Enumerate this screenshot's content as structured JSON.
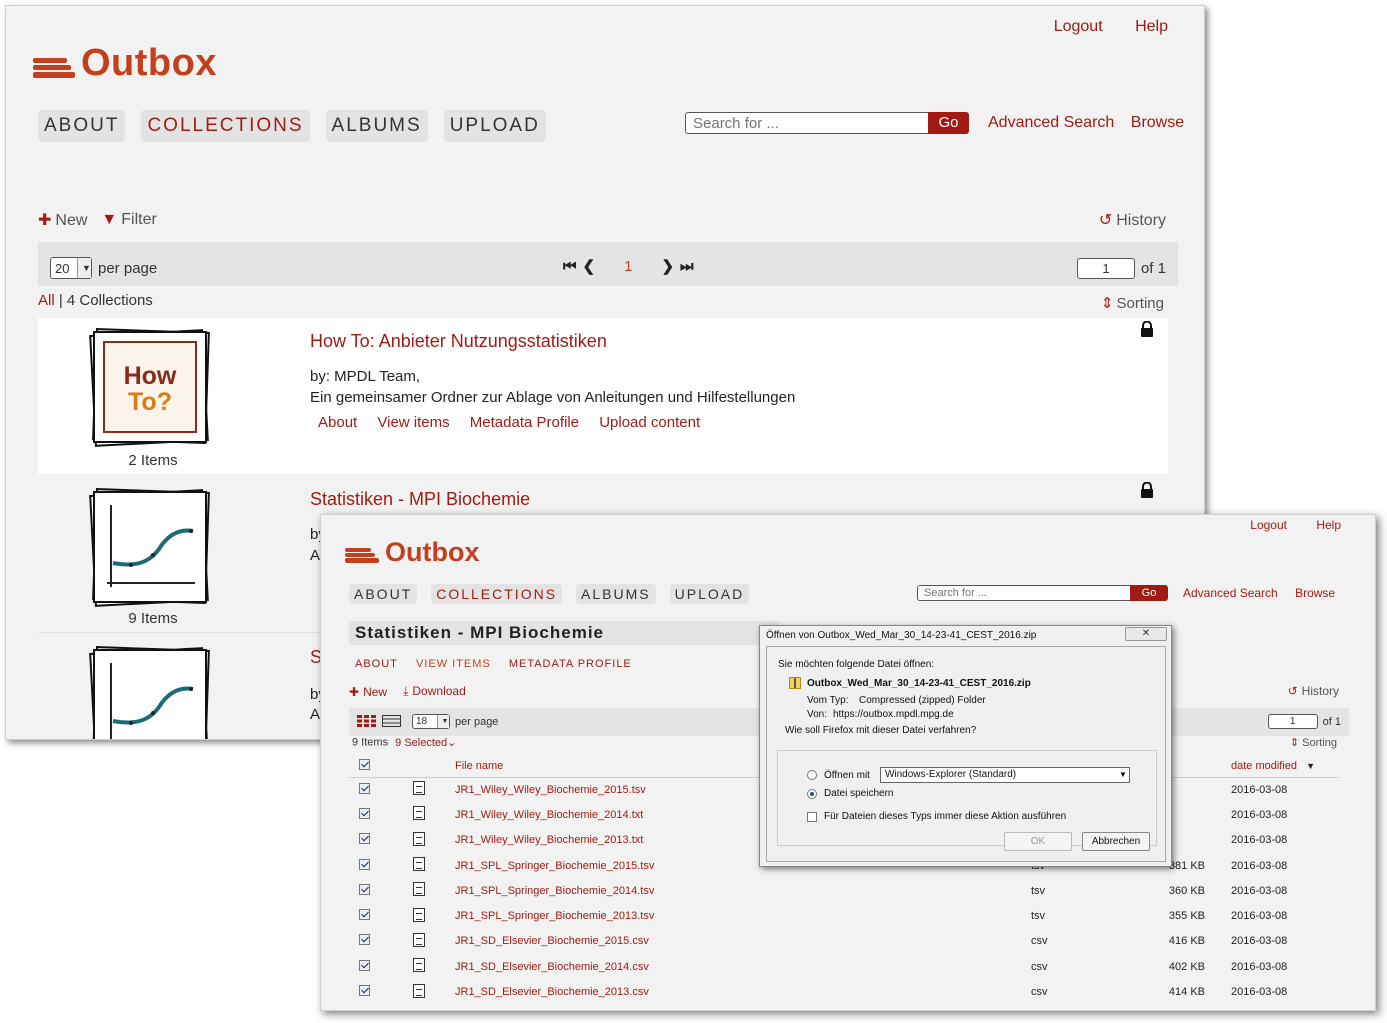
{
  "brand": {
    "name": "Outbox",
    "color": "#c2411c",
    "accent": "#a11b14"
  },
  "w1": {
    "top_links": [
      "Logout",
      "Help"
    ],
    "nav": [
      {
        "label": "ABOUT",
        "active": false
      },
      {
        "label": "COLLECTIONS",
        "active": true
      },
      {
        "label": "ALBUMS",
        "active": false
      },
      {
        "label": "UPLOAD",
        "active": false
      }
    ],
    "search": {
      "placeholder": "Search for ...",
      "go": "Go",
      "advanced": "Advanced Search",
      "browse": "Browse"
    },
    "toolbar": {
      "new": "New",
      "filter": "Filter",
      "history": "History"
    },
    "pager": {
      "per_page_value": "20",
      "per_page_label": "per page",
      "current_page": "1",
      "page_input": "1",
      "of_label": "of 1"
    },
    "count": {
      "all": "All",
      "separator": "|",
      "text": "4 Collections"
    },
    "sorting": "Sorting",
    "collections": [
      {
        "title": "How To: Anbieter Nutzungsstatistiken",
        "thumb_text": [
          "How",
          "To?"
        ],
        "by": "by: MPDL Team,",
        "description": "Ein gemeinsamer Ordner zur Ablage von Anleitungen und Hilfestellungen",
        "actions": [
          "About",
          "View items",
          "Metadata Profile",
          "Upload content"
        ],
        "items": "2 Items",
        "locked": true
      },
      {
        "title": "Statistiken - MPI Biochemie",
        "by": "by",
        "description": "A",
        "items": "9 Items",
        "locked": true
      },
      {
        "title": "S",
        "by": "by",
        "description": "A",
        "locked": false
      }
    ]
  },
  "w2": {
    "top_links": [
      "Logout",
      "Help"
    ],
    "nav": [
      {
        "label": "ABOUT",
        "active": false
      },
      {
        "label": "COLLECTIONS",
        "active": true
      },
      {
        "label": "ALBUMS",
        "active": false
      },
      {
        "label": "UPLOAD",
        "active": false
      }
    ],
    "search": {
      "placeholder": "Search for ...",
      "go": "Go",
      "advanced": "Advanced Search",
      "browse": "Browse"
    },
    "page_title": "Statistiken - MPI Biochemie",
    "subnav": [
      {
        "label": "ABOUT",
        "active": false
      },
      {
        "label": "VIEW ITEMS",
        "active": true
      },
      {
        "label": "METADATA PROFILE",
        "active": false
      }
    ],
    "toolbar": {
      "new": "New",
      "download": "Download",
      "history": "History"
    },
    "pager": {
      "per_page_value": "18",
      "per_page_label": "per page",
      "page_input": "1",
      "of_label": "of 1"
    },
    "count": {
      "items": "9 Items",
      "selected": "9 Selected"
    },
    "sorting": "Sorting",
    "table": {
      "headers": {
        "file_name": "File name",
        "date_modified": "date modified"
      },
      "rows": [
        {
          "name": "JR1_Wiley_Wiley_Biochemie_2015.tsv",
          "type": "",
          "size": "",
          "date": "2016-03-08"
        },
        {
          "name": "JR1_Wiley_Wiley_Biochemie_2014.txt",
          "type": "",
          "size": "",
          "date": "2016-03-08"
        },
        {
          "name": "JR1_Wiley_Wiley_Biochemie_2013.txt",
          "type": "",
          "size": "",
          "date": "2016-03-08"
        },
        {
          "name": "JR1_SPL_Springer_Biochemie_2015.tsv",
          "type": "tsv",
          "size": "381 KB",
          "date": "2016-03-08"
        },
        {
          "name": "JR1_SPL_Springer_Biochemie_2014.tsv",
          "type": "tsv",
          "size": "360 KB",
          "date": "2016-03-08"
        },
        {
          "name": "JR1_SPL_Springer_Biochemie_2013.tsv",
          "type": "tsv",
          "size": "355 KB",
          "date": "2016-03-08"
        },
        {
          "name": "JR1_SD_Elsevier_Biochemie_2015.csv",
          "type": "csv",
          "size": "416 KB",
          "date": "2016-03-08"
        },
        {
          "name": "JR1_SD_Elsevier_Biochemie_2014.csv",
          "type": "csv",
          "size": "402 KB",
          "date": "2016-03-08"
        },
        {
          "name": "JR1_SD_Elsevier_Biochemie_2013.csv",
          "type": "csv",
          "size": "414 KB",
          "date": "2016-03-08"
        }
      ]
    }
  },
  "dialog": {
    "title": "Öffnen von Outbox_Wed_Mar_30_14-23-41_CEST_2016.zip",
    "question": "Sie möchten folgende Datei öffnen:",
    "file_name": "Outbox_Wed_Mar_30_14-23-41_CEST_2016.zip",
    "type_label": "Vom Typ:",
    "type_value": "Compressed (zipped) Folder",
    "from_label": "Von:",
    "from_value": "https://outbox.mpdl.mpg.de",
    "action_question": "Wie soll Firefox mit dieser Datei verfahren?",
    "open_with": "Öffnen mit",
    "open_with_app": "Windows-Explorer (Standard)",
    "save_file": "Datei speichern",
    "always": "Für Dateien dieses Typs immer diese Aktion ausführen",
    "ok": "OK",
    "cancel": "Abbrechen"
  }
}
